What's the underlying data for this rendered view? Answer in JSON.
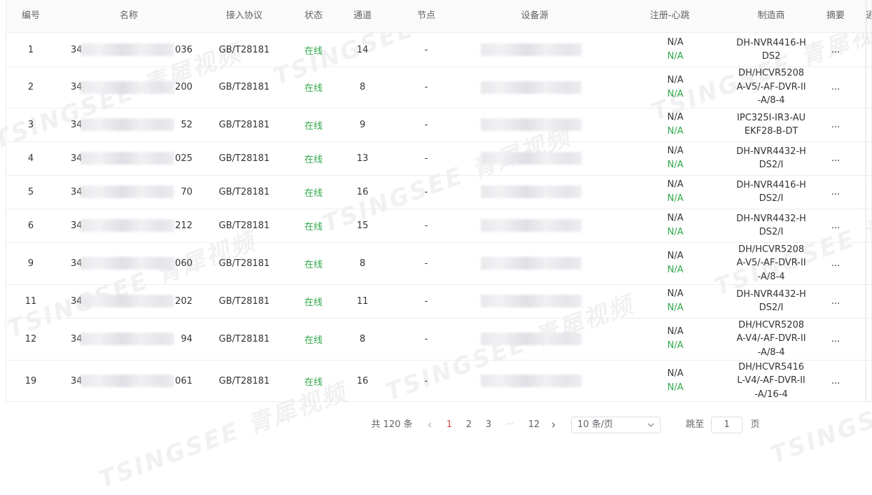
{
  "columns": [
    "编号",
    "名称",
    "接入协议",
    "状态",
    "通道",
    "节点",
    "设备源",
    "注册-心跳",
    "制造商",
    "摘要",
    "通"
  ],
  "rows": [
    {
      "id": "1",
      "name_prefix": "34",
      "name_suffix": "036",
      "protocol": "GB/T28181",
      "status": "在线",
      "channels": "14",
      "node": "-",
      "reg": "N/A",
      "hb": "N/A",
      "mfr": "DH-NVR4416-HDS2",
      "summary": "..."
    },
    {
      "id": "2",
      "name_prefix": "34",
      "name_suffix": "200",
      "protocol": "GB/T28181",
      "status": "在线",
      "channels": "8",
      "node": "-",
      "reg": "N/A",
      "hb": "N/A",
      "mfr": "DH/HCVR5208A-V5/-AF-DVR-II-A/8-4",
      "summary": "..."
    },
    {
      "id": "3",
      "name_prefix": "34",
      "name_suffix": "52",
      "protocol": "GB/T28181",
      "status": "在线",
      "channels": "9",
      "node": "-",
      "reg": "N/A",
      "hb": "N/A",
      "mfr": "IPC325I-IR3-AUEKF28-B-DT",
      "summary": "..."
    },
    {
      "id": "4",
      "name_prefix": "34",
      "name_suffix": "025",
      "protocol": "GB/T28181",
      "status": "在线",
      "channels": "13",
      "node": "-",
      "reg": "N/A",
      "hb": "N/A",
      "mfr": "DH-NVR4432-HDS2/I",
      "summary": "..."
    },
    {
      "id": "5",
      "name_prefix": "34",
      "name_suffix": "70",
      "protocol": "GB/T28181",
      "status": "在线",
      "channels": "16",
      "node": "-",
      "reg": "N/A",
      "hb": "N/A",
      "mfr": "DH-NVR4416-HDS2/I",
      "summary": "..."
    },
    {
      "id": "6",
      "name_prefix": "34",
      "name_suffix": "212",
      "protocol": "GB/T28181",
      "status": "在线",
      "channels": "15",
      "node": "-",
      "reg": "N/A",
      "hb": "N/A",
      "mfr": "DH-NVR4432-HDS2/I",
      "summary": "..."
    },
    {
      "id": "9",
      "name_prefix": "34",
      "name_suffix": "060",
      "protocol": "GB/T28181",
      "status": "在线",
      "channels": "8",
      "node": "-",
      "reg": "N/A",
      "hb": "N/A",
      "mfr": "DH/HCVR5208A-V5/-AF-DVR-II-A/8-4",
      "summary": "..."
    },
    {
      "id": "11",
      "name_prefix": "34",
      "name_suffix": "202",
      "protocol": "GB/T28181",
      "status": "在线",
      "channels": "11",
      "node": "-",
      "reg": "N/A",
      "hb": "N/A",
      "mfr": "DH-NVR4432-HDS2/I",
      "summary": "..."
    },
    {
      "id": "12",
      "name_prefix": "34",
      "name_suffix": "94",
      "protocol": "GB/T28181",
      "status": "在线",
      "channels": "8",
      "node": "-",
      "reg": "N/A",
      "hb": "N/A",
      "mfr": "DH/HCVR5208A-V4/-AF-DVR-II-A/8-4",
      "summary": "..."
    },
    {
      "id": "19",
      "name_prefix": "34",
      "name_suffix": "061",
      "protocol": "GB/T28181",
      "status": "在线",
      "channels": "16",
      "node": "-",
      "reg": "N/A",
      "hb": "N/A",
      "mfr": "DH/HCVR5416L-V4/-AF-DVR-II-A/16-4",
      "summary": "..."
    }
  ],
  "pagination": {
    "total": "共 120 条",
    "prev": "‹",
    "pages": [
      "1",
      "2",
      "3"
    ],
    "ellipsis": "···",
    "last": "12",
    "next": "›",
    "page_size": "10 条/页",
    "jump_label": "跳至",
    "jump_value": "1",
    "jump_unit": "页"
  },
  "watermark": "TSINGSEE 青犀视频",
  "colors": {
    "online": "#2ea84a",
    "active_page": "#e8483b",
    "header_bg": "#fafafa",
    "border": "#ebeef5"
  }
}
